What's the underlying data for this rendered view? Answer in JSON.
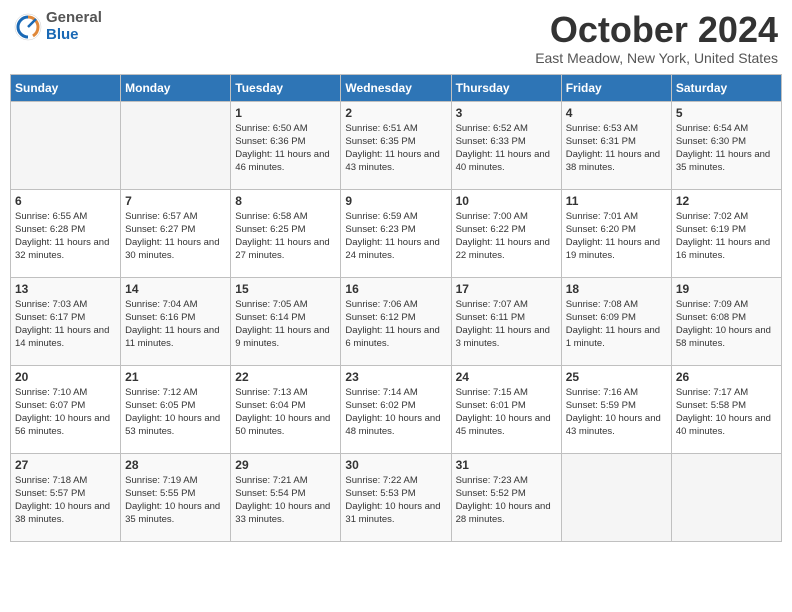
{
  "header": {
    "logo_general": "General",
    "logo_blue": "Blue",
    "month_title": "October 2024",
    "location": "East Meadow, New York, United States"
  },
  "days_of_week": [
    "Sunday",
    "Monday",
    "Tuesday",
    "Wednesday",
    "Thursday",
    "Friday",
    "Saturday"
  ],
  "weeks": [
    [
      {
        "num": "",
        "info": ""
      },
      {
        "num": "",
        "info": ""
      },
      {
        "num": "1",
        "info": "Sunrise: 6:50 AM\nSunset: 6:36 PM\nDaylight: 11 hours and 46 minutes."
      },
      {
        "num": "2",
        "info": "Sunrise: 6:51 AM\nSunset: 6:35 PM\nDaylight: 11 hours and 43 minutes."
      },
      {
        "num": "3",
        "info": "Sunrise: 6:52 AM\nSunset: 6:33 PM\nDaylight: 11 hours and 40 minutes."
      },
      {
        "num": "4",
        "info": "Sunrise: 6:53 AM\nSunset: 6:31 PM\nDaylight: 11 hours and 38 minutes."
      },
      {
        "num": "5",
        "info": "Sunrise: 6:54 AM\nSunset: 6:30 PM\nDaylight: 11 hours and 35 minutes."
      }
    ],
    [
      {
        "num": "6",
        "info": "Sunrise: 6:55 AM\nSunset: 6:28 PM\nDaylight: 11 hours and 32 minutes."
      },
      {
        "num": "7",
        "info": "Sunrise: 6:57 AM\nSunset: 6:27 PM\nDaylight: 11 hours and 30 minutes."
      },
      {
        "num": "8",
        "info": "Sunrise: 6:58 AM\nSunset: 6:25 PM\nDaylight: 11 hours and 27 minutes."
      },
      {
        "num": "9",
        "info": "Sunrise: 6:59 AM\nSunset: 6:23 PM\nDaylight: 11 hours and 24 minutes."
      },
      {
        "num": "10",
        "info": "Sunrise: 7:00 AM\nSunset: 6:22 PM\nDaylight: 11 hours and 22 minutes."
      },
      {
        "num": "11",
        "info": "Sunrise: 7:01 AM\nSunset: 6:20 PM\nDaylight: 11 hours and 19 minutes."
      },
      {
        "num": "12",
        "info": "Sunrise: 7:02 AM\nSunset: 6:19 PM\nDaylight: 11 hours and 16 minutes."
      }
    ],
    [
      {
        "num": "13",
        "info": "Sunrise: 7:03 AM\nSunset: 6:17 PM\nDaylight: 11 hours and 14 minutes."
      },
      {
        "num": "14",
        "info": "Sunrise: 7:04 AM\nSunset: 6:16 PM\nDaylight: 11 hours and 11 minutes."
      },
      {
        "num": "15",
        "info": "Sunrise: 7:05 AM\nSunset: 6:14 PM\nDaylight: 11 hours and 9 minutes."
      },
      {
        "num": "16",
        "info": "Sunrise: 7:06 AM\nSunset: 6:12 PM\nDaylight: 11 hours and 6 minutes."
      },
      {
        "num": "17",
        "info": "Sunrise: 7:07 AM\nSunset: 6:11 PM\nDaylight: 11 hours and 3 minutes."
      },
      {
        "num": "18",
        "info": "Sunrise: 7:08 AM\nSunset: 6:09 PM\nDaylight: 11 hours and 1 minute."
      },
      {
        "num": "19",
        "info": "Sunrise: 7:09 AM\nSunset: 6:08 PM\nDaylight: 10 hours and 58 minutes."
      }
    ],
    [
      {
        "num": "20",
        "info": "Sunrise: 7:10 AM\nSunset: 6:07 PM\nDaylight: 10 hours and 56 minutes."
      },
      {
        "num": "21",
        "info": "Sunrise: 7:12 AM\nSunset: 6:05 PM\nDaylight: 10 hours and 53 minutes."
      },
      {
        "num": "22",
        "info": "Sunrise: 7:13 AM\nSunset: 6:04 PM\nDaylight: 10 hours and 50 minutes."
      },
      {
        "num": "23",
        "info": "Sunrise: 7:14 AM\nSunset: 6:02 PM\nDaylight: 10 hours and 48 minutes."
      },
      {
        "num": "24",
        "info": "Sunrise: 7:15 AM\nSunset: 6:01 PM\nDaylight: 10 hours and 45 minutes."
      },
      {
        "num": "25",
        "info": "Sunrise: 7:16 AM\nSunset: 5:59 PM\nDaylight: 10 hours and 43 minutes."
      },
      {
        "num": "26",
        "info": "Sunrise: 7:17 AM\nSunset: 5:58 PM\nDaylight: 10 hours and 40 minutes."
      }
    ],
    [
      {
        "num": "27",
        "info": "Sunrise: 7:18 AM\nSunset: 5:57 PM\nDaylight: 10 hours and 38 minutes."
      },
      {
        "num": "28",
        "info": "Sunrise: 7:19 AM\nSunset: 5:55 PM\nDaylight: 10 hours and 35 minutes."
      },
      {
        "num": "29",
        "info": "Sunrise: 7:21 AM\nSunset: 5:54 PM\nDaylight: 10 hours and 33 minutes."
      },
      {
        "num": "30",
        "info": "Sunrise: 7:22 AM\nSunset: 5:53 PM\nDaylight: 10 hours and 31 minutes."
      },
      {
        "num": "31",
        "info": "Sunrise: 7:23 AM\nSunset: 5:52 PM\nDaylight: 10 hours and 28 minutes."
      },
      {
        "num": "",
        "info": ""
      },
      {
        "num": "",
        "info": ""
      }
    ]
  ]
}
